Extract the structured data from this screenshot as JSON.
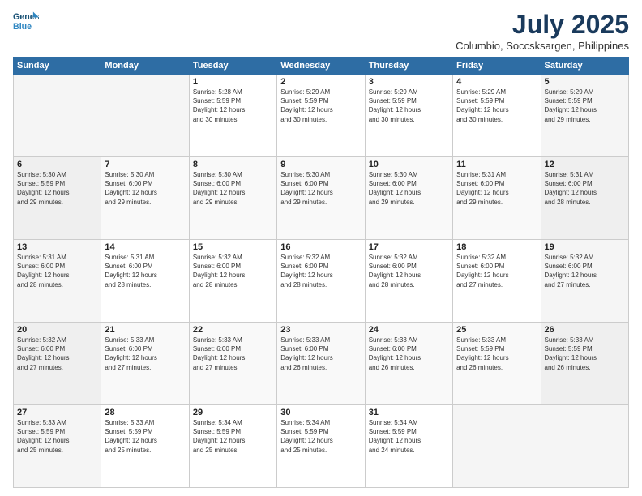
{
  "header": {
    "logo_line1": "General",
    "logo_line2": "Blue",
    "month_year": "July 2025",
    "location": "Columbio, Soccsksargen, Philippines"
  },
  "days_of_week": [
    "Sunday",
    "Monday",
    "Tuesday",
    "Wednesday",
    "Thursday",
    "Friday",
    "Saturday"
  ],
  "weeks": [
    {
      "days": [
        {
          "num": "",
          "info": ""
        },
        {
          "num": "",
          "info": ""
        },
        {
          "num": "1",
          "info": "Sunrise: 5:28 AM\nSunset: 5:59 PM\nDaylight: 12 hours\nand 30 minutes."
        },
        {
          "num": "2",
          "info": "Sunrise: 5:29 AM\nSunset: 5:59 PM\nDaylight: 12 hours\nand 30 minutes."
        },
        {
          "num": "3",
          "info": "Sunrise: 5:29 AM\nSunset: 5:59 PM\nDaylight: 12 hours\nand 30 minutes."
        },
        {
          "num": "4",
          "info": "Sunrise: 5:29 AM\nSunset: 5:59 PM\nDaylight: 12 hours\nand 30 minutes."
        },
        {
          "num": "5",
          "info": "Sunrise: 5:29 AM\nSunset: 5:59 PM\nDaylight: 12 hours\nand 29 minutes."
        }
      ]
    },
    {
      "days": [
        {
          "num": "6",
          "info": "Sunrise: 5:30 AM\nSunset: 5:59 PM\nDaylight: 12 hours\nand 29 minutes."
        },
        {
          "num": "7",
          "info": "Sunrise: 5:30 AM\nSunset: 6:00 PM\nDaylight: 12 hours\nand 29 minutes."
        },
        {
          "num": "8",
          "info": "Sunrise: 5:30 AM\nSunset: 6:00 PM\nDaylight: 12 hours\nand 29 minutes."
        },
        {
          "num": "9",
          "info": "Sunrise: 5:30 AM\nSunset: 6:00 PM\nDaylight: 12 hours\nand 29 minutes."
        },
        {
          "num": "10",
          "info": "Sunrise: 5:30 AM\nSunset: 6:00 PM\nDaylight: 12 hours\nand 29 minutes."
        },
        {
          "num": "11",
          "info": "Sunrise: 5:31 AM\nSunset: 6:00 PM\nDaylight: 12 hours\nand 29 minutes."
        },
        {
          "num": "12",
          "info": "Sunrise: 5:31 AM\nSunset: 6:00 PM\nDaylight: 12 hours\nand 28 minutes."
        }
      ]
    },
    {
      "days": [
        {
          "num": "13",
          "info": "Sunrise: 5:31 AM\nSunset: 6:00 PM\nDaylight: 12 hours\nand 28 minutes."
        },
        {
          "num": "14",
          "info": "Sunrise: 5:31 AM\nSunset: 6:00 PM\nDaylight: 12 hours\nand 28 minutes."
        },
        {
          "num": "15",
          "info": "Sunrise: 5:32 AM\nSunset: 6:00 PM\nDaylight: 12 hours\nand 28 minutes."
        },
        {
          "num": "16",
          "info": "Sunrise: 5:32 AM\nSunset: 6:00 PM\nDaylight: 12 hours\nand 28 minutes."
        },
        {
          "num": "17",
          "info": "Sunrise: 5:32 AM\nSunset: 6:00 PM\nDaylight: 12 hours\nand 28 minutes."
        },
        {
          "num": "18",
          "info": "Sunrise: 5:32 AM\nSunset: 6:00 PM\nDaylight: 12 hours\nand 27 minutes."
        },
        {
          "num": "19",
          "info": "Sunrise: 5:32 AM\nSunset: 6:00 PM\nDaylight: 12 hours\nand 27 minutes."
        }
      ]
    },
    {
      "days": [
        {
          "num": "20",
          "info": "Sunrise: 5:32 AM\nSunset: 6:00 PM\nDaylight: 12 hours\nand 27 minutes."
        },
        {
          "num": "21",
          "info": "Sunrise: 5:33 AM\nSunset: 6:00 PM\nDaylight: 12 hours\nand 27 minutes."
        },
        {
          "num": "22",
          "info": "Sunrise: 5:33 AM\nSunset: 6:00 PM\nDaylight: 12 hours\nand 27 minutes."
        },
        {
          "num": "23",
          "info": "Sunrise: 5:33 AM\nSunset: 6:00 PM\nDaylight: 12 hours\nand 26 minutes."
        },
        {
          "num": "24",
          "info": "Sunrise: 5:33 AM\nSunset: 6:00 PM\nDaylight: 12 hours\nand 26 minutes."
        },
        {
          "num": "25",
          "info": "Sunrise: 5:33 AM\nSunset: 5:59 PM\nDaylight: 12 hours\nand 26 minutes."
        },
        {
          "num": "26",
          "info": "Sunrise: 5:33 AM\nSunset: 5:59 PM\nDaylight: 12 hours\nand 26 minutes."
        }
      ]
    },
    {
      "days": [
        {
          "num": "27",
          "info": "Sunrise: 5:33 AM\nSunset: 5:59 PM\nDaylight: 12 hours\nand 25 minutes."
        },
        {
          "num": "28",
          "info": "Sunrise: 5:33 AM\nSunset: 5:59 PM\nDaylight: 12 hours\nand 25 minutes."
        },
        {
          "num": "29",
          "info": "Sunrise: 5:34 AM\nSunset: 5:59 PM\nDaylight: 12 hours\nand 25 minutes."
        },
        {
          "num": "30",
          "info": "Sunrise: 5:34 AM\nSunset: 5:59 PM\nDaylight: 12 hours\nand 25 minutes."
        },
        {
          "num": "31",
          "info": "Sunrise: 5:34 AM\nSunset: 5:59 PM\nDaylight: 12 hours\nand 24 minutes."
        },
        {
          "num": "",
          "info": ""
        },
        {
          "num": "",
          "info": ""
        }
      ]
    }
  ]
}
